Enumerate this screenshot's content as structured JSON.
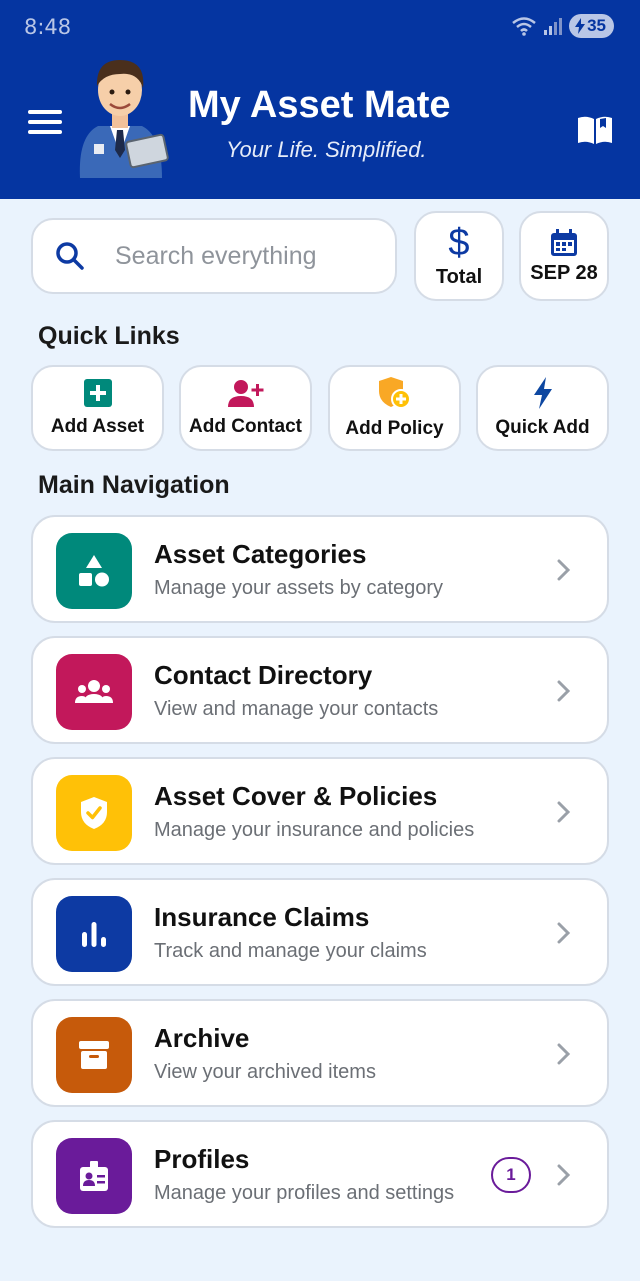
{
  "status_bar": {
    "time": "8:48",
    "battery": "35"
  },
  "header": {
    "title": "My Asset Mate",
    "subtitle": "Your Life. Simplified."
  },
  "search": {
    "placeholder": "Search everything"
  },
  "summary": {
    "total_label": "Total",
    "date_label": "SEP 28"
  },
  "quick_links": {
    "title": "Quick Links",
    "items": [
      {
        "label": "Add Asset",
        "icon": "plus-square-icon",
        "color": "#00897b"
      },
      {
        "label": "Add Contact",
        "icon": "person-add-icon",
        "color": "#c2185b"
      },
      {
        "label": "Add Policy",
        "icon": "shield-add-icon",
        "color": "#f9a825"
      },
      {
        "label": "Quick Add",
        "icon": "bolt-icon",
        "color": "#0d47a1"
      }
    ]
  },
  "main_nav": {
    "title": "Main Navigation",
    "items": [
      {
        "title": "Asset Categories",
        "subtitle": "Manage your assets by category",
        "icon": "shapes-icon",
        "color": "#00897b"
      },
      {
        "title": "Contact Directory",
        "subtitle": "View and manage your contacts",
        "icon": "people-icon",
        "color": "#c2185b"
      },
      {
        "title": "Asset Cover & Policies",
        "subtitle": "Manage your insurance and policies",
        "icon": "shield-check-icon",
        "color": "#ffc107"
      },
      {
        "title": "Insurance Claims",
        "subtitle": "Track and manage your claims",
        "icon": "bar-chart-icon",
        "color": "#0d3aa3"
      },
      {
        "title": "Archive",
        "subtitle": "View your archived items",
        "icon": "archive-box-icon",
        "color": "#c65a0b"
      },
      {
        "title": "Profiles",
        "subtitle": "Manage your profiles and settings",
        "icon": "id-badge-icon",
        "color": "#6a1b9a",
        "badge": "1"
      }
    ]
  }
}
